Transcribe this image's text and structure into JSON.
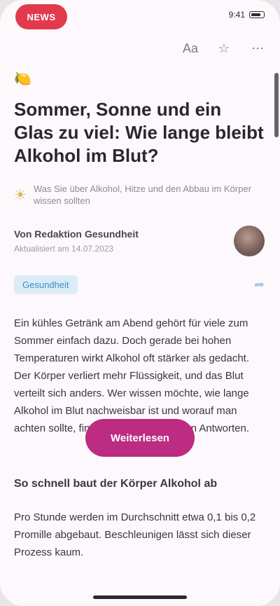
{
  "status_bar": {
    "logo_label": "NEWS",
    "time": "9:41"
  },
  "toolbar": {
    "items": [
      {
        "name": "text-size-icon",
        "glyph": "Aa"
      },
      {
        "name": "bookmark-icon",
        "glyph": "☆"
      },
      {
        "name": "more-icon",
        "glyph": "⋯"
      }
    ]
  },
  "article": {
    "emoji": "🍋",
    "category": "",
    "headline": "Sommer, Sonne und ein Glas zu viel: Wie lange bleibt Alkohol im Blut?",
    "byline_icon": "sun-icon",
    "byline": "Was Sie über Alkohol, Hitze und den Abbau im Körper wissen sollten",
    "author": "Von Redaktion Gesundheit",
    "date": "Aktualisiert am 14.07.2023",
    "topic": "Gesundheit",
    "paragraphs": [
      "Ein kühles Getränk am Abend gehört für viele zum Sommer einfach dazu. Doch gerade bei hohen Temperaturen wirkt Alkohol oft stärker als gedacht. Der Körper verliert mehr Flüssigkeit, und das Blut verteilt sich anders. Wer wissen möchte, wie lange Alkohol im Blut nachweisbar ist und worauf man achten sollte, findet hier die wichtigsten Antworten."
    ]
  },
  "cta": {
    "label": "Weiterlesen"
  },
  "section": {
    "title": "So schnell baut der Körper Alkohol ab",
    "body": "Pro Stunde werden im Durchschnitt etwa 0,1 bis 0,2 Promille abgebaut. Beschleunigen lässt sich dieser Prozess kaum."
  }
}
